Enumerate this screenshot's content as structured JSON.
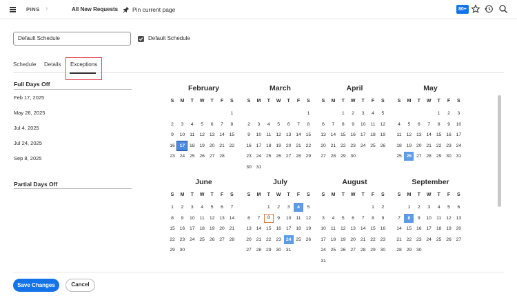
{
  "topbar": {
    "app": "PINS",
    "page": "All New Requests",
    "pin_label": "Pin current page",
    "badge": "80+"
  },
  "schedule": {
    "name_value": "Default Schedule",
    "default_checkbox_label": "Default Schedule",
    "default_checked": true
  },
  "tabs": [
    {
      "label": "Schedule"
    },
    {
      "label": "Details"
    },
    {
      "label": "Exceptions",
      "active": true
    }
  ],
  "full_days_off": {
    "title": "Full Days Off",
    "dates": [
      "Feb 17, 2025",
      "May 26, 2025",
      "Jul 4, 2025",
      "Jul 24, 2025",
      "Sep 8, 2025"
    ]
  },
  "partial_days_off": {
    "title": "Partial Days Off"
  },
  "weekday_headers": [
    "S",
    "M",
    "T",
    "W",
    "T",
    "F",
    "S"
  ],
  "months": [
    {
      "name": "February",
      "start": 6,
      "days": 28,
      "highlight": [
        17
      ],
      "highlight_style": "dark"
    },
    {
      "name": "March",
      "start": 6,
      "days": 31,
      "highlight": []
    },
    {
      "name": "April",
      "start": 2,
      "days": 30,
      "highlight": []
    },
    {
      "name": "May",
      "start": 4,
      "days": 31,
      "highlight": [
        26
      ]
    },
    {
      "name": "June",
      "start": 0,
      "days": 30,
      "highlight": []
    },
    {
      "name": "July",
      "start": 2,
      "days": 31,
      "highlight": [
        4,
        24
      ],
      "outline": [
        8
      ]
    },
    {
      "name": "August",
      "start": 5,
      "days": 31,
      "highlight": []
    },
    {
      "name": "September",
      "start": 1,
      "days": 30,
      "highlight": [
        8
      ]
    }
  ],
  "footer": {
    "save_label": "Save Changes",
    "cancel_label": "Cancel"
  },
  "colors": {
    "accent": "#1473e6",
    "highlight_day": "#5c9be6",
    "active_tab_box": "#e34850"
  }
}
